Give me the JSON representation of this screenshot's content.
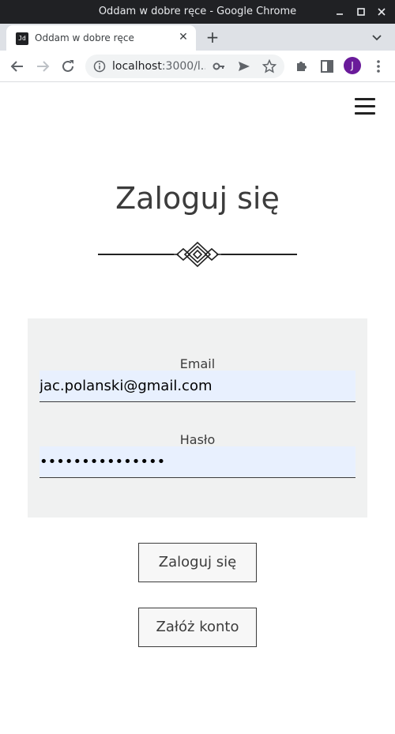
{
  "window": {
    "title": "Oddam w dobre ręce - Google Chrome"
  },
  "tab": {
    "title": "Oddam w dobre ręce",
    "favicon_text": "Jd"
  },
  "address_bar": {
    "host": "localhost",
    "rest": ":3000/l..."
  },
  "profile": {
    "initial": "J"
  },
  "page": {
    "heading": "Zaloguj się",
    "form": {
      "email_label": "Email",
      "email_value": "jac.polanski@gmail.com",
      "password_label": "Hasło",
      "password_masked": "•••••••••••••••"
    },
    "login_button": "Zaloguj się",
    "register_button": "Załóż konto"
  },
  "colors": {
    "form_background": "#f0f1f1",
    "autofill_background": "#e8f0fe",
    "text": "#3c3c3c",
    "avatar": "#6a1b9a"
  }
}
